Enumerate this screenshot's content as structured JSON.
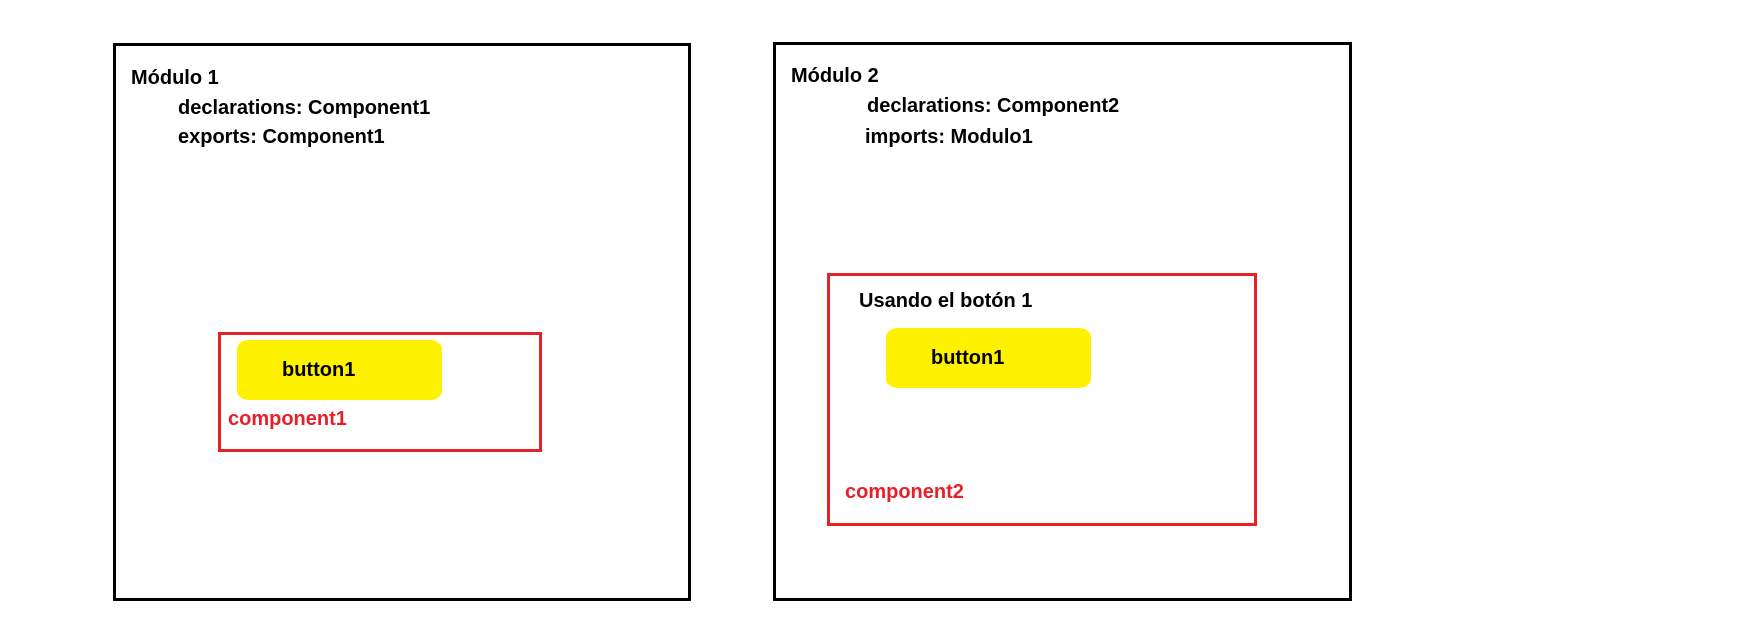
{
  "module1": {
    "title": "Módulo 1",
    "declarations": "declarations: Component1",
    "exports": "exports: Component1",
    "component": {
      "button_label": "button1",
      "label": "component1"
    }
  },
  "module2": {
    "title": "Módulo  2",
    "declarations": "declarations: Component2",
    "imports": "imports: Modulo1",
    "component": {
      "caption": "Usando el botón 1",
      "button_label": "button1",
      "label": "component2"
    }
  },
  "colors": {
    "module_border": "#000000",
    "component_border": "#e8202a",
    "component_label": "#e8202a",
    "button_fill": "#fff200"
  }
}
